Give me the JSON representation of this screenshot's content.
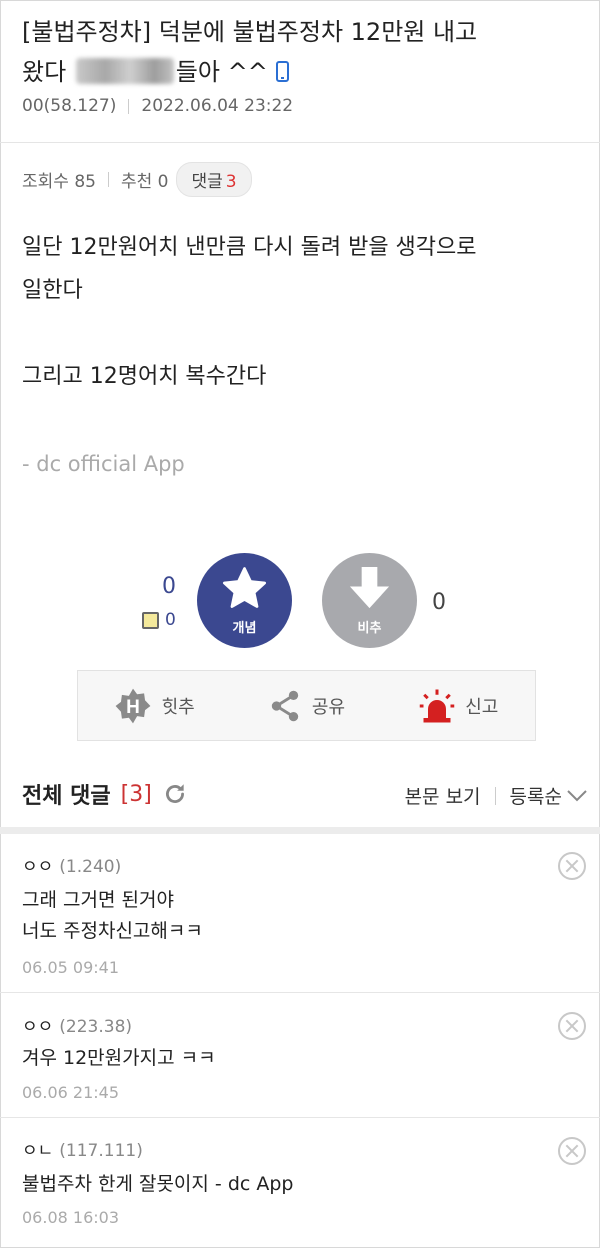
{
  "post": {
    "title_part1": "[불법주정차] 덕분에 불법주정차 12만원 내고",
    "title_part2_pre": "왔다 ",
    "title_part2_post": "들아 ^^",
    "author": "00(58.127)",
    "datetime": "2022.06.04 23:22",
    "views_label": "조회수 85",
    "recommend_label": "추천 0",
    "comment_pill_label": "댓글",
    "comment_pill_count": "3",
    "body_line1": "일단 12만원어치 낸만큼 다시 돌려 받을 생각으로",
    "body_line2": "일한다",
    "body_line3": "그리고 12명어치 복수간다",
    "signature": "- dc official App"
  },
  "vote": {
    "up_count": "0",
    "up_sub_count": "0",
    "up_label": "개념",
    "down_label": "비추",
    "down_count": "0"
  },
  "actions": {
    "hit_label": "힛추",
    "share_label": "공유",
    "report_label": "신고"
  },
  "comments_header": {
    "title": "전체 댓글",
    "count": "[3]",
    "view_post_label": "본문 보기",
    "sort_label": "등록순"
  },
  "comments": [
    {
      "user": "ㅇㅇ",
      "ip": "(1.240)",
      "line1": "그래 그거면 된거야",
      "line2": "너도 주정차신고해ㅋㅋ",
      "date": "06.05 09:41"
    },
    {
      "user": "ㅇㅇ",
      "ip": "(223.38)",
      "line1": "겨우 12만원가지고 ㅋㅋ",
      "line2": "",
      "date": "06.06 21:45"
    },
    {
      "user": "ㅇㄴ",
      "ip": "(117.111)",
      "line1": "불법주차 한게 잘못이지 - dc App",
      "line2": "",
      "date": "06.08 16:03"
    }
  ],
  "colors": {
    "upvote": "#3b4890",
    "downvote": "#a8a9ad",
    "accent_red": "#d33",
    "mobile_icon": "#2b6fd3"
  }
}
